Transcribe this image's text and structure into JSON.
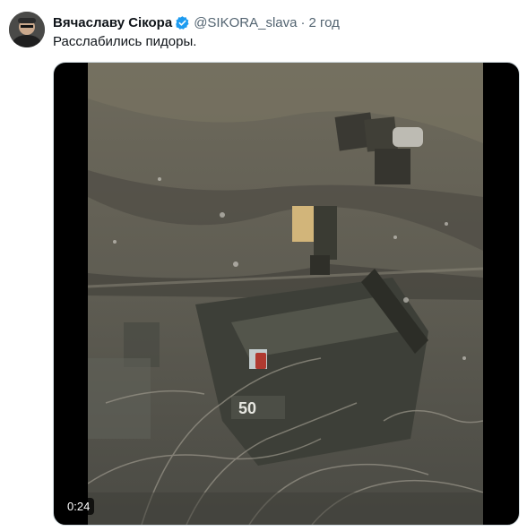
{
  "author": {
    "display_name": "Вячаславу Сікора",
    "handle": "@SIKORA_slava",
    "separator": "·",
    "time": "2 год",
    "verified_color": "#1d9bf0"
  },
  "tweet": {
    "text": "Расслабились пидоры."
  },
  "video": {
    "duration": "0:24",
    "overlay_text": "50"
  }
}
